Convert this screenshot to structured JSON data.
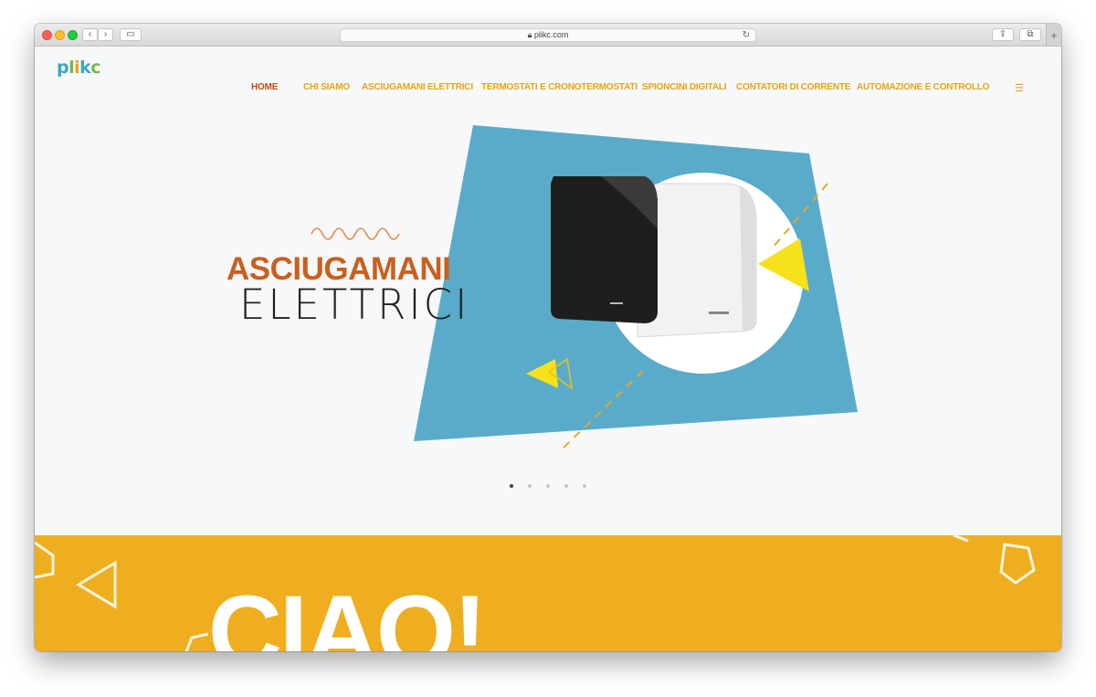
{
  "browser": {
    "url": "plikc.com",
    "tab_plus": "+"
  },
  "site": {
    "logo_letters": [
      "p",
      "l",
      "i",
      "k",
      "c"
    ],
    "logo_colors": [
      "#3aa7c9",
      "#7ab648",
      "#e8a413",
      "#3aa7c9",
      "#7ab648"
    ]
  },
  "nav": {
    "items": [
      {
        "label": "HOME",
        "active": true
      },
      {
        "label": "CHI SIAMO",
        "active": false
      },
      {
        "label": "ASCIUGAMANI ELETTRICI",
        "active": false
      },
      {
        "label": "TERMOSTATI E CRONOTERMOSTATI",
        "active": false
      },
      {
        "label": "SPIONCINI DIGITALI",
        "active": false
      },
      {
        "label": "CONTATORI DI CORRENTE",
        "active": false
      },
      {
        "label": "AUTOMAZIONE E CONTROLLO",
        "active": false
      }
    ],
    "menu_icon": "list-icon"
  },
  "hero": {
    "title": "ASCIUGAMANI",
    "subtitle": "ELETTRICI",
    "slides_count": 5,
    "active_slide": 1
  },
  "intro": {
    "heading": "CIAO!"
  },
  "colors": {
    "accent_orange": "#c9601f",
    "accent_yellow": "#efae20",
    "blue_panel": "#5aabc9",
    "triangle_yellow": "#f7e11a"
  }
}
